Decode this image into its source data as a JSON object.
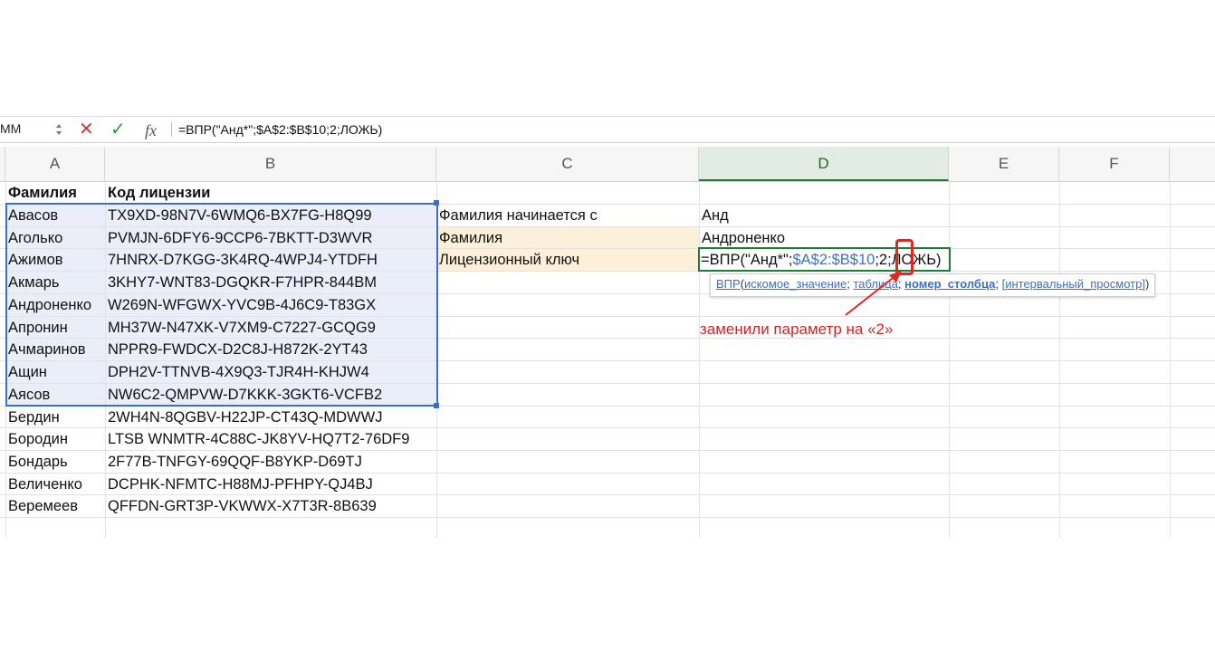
{
  "formula_bar": {
    "name_box": "MM",
    "fx_label": "fx",
    "formula": "=ВПР(\"Анд*\";$A$2:$B$10;2;ЛОЖЬ)"
  },
  "columns": [
    "A",
    "B",
    "C",
    "D",
    "E",
    "F"
  ],
  "headers": {
    "surname": "Фамилия",
    "license": "Код лицензии"
  },
  "rows": [
    {
      "surname": "Авасов",
      "code": "TX9XD-98N7V-6WMQ6-BX7FG-H8Q99"
    },
    {
      "surname": "Аголько",
      "code": "PVMJN-6DFY6-9CCP6-7BKTT-D3WVR"
    },
    {
      "surname": "Ажимов",
      "code": "7HNRX-D7KGG-3K4RQ-4WPJ4-YTDFH"
    },
    {
      "surname": "Акмарь",
      "code": "3KHY7-WNT83-DGQKR-F7HPR-844BM"
    },
    {
      "surname": "Андроненко",
      "code": "W269N-WFGWX-YVC9B-4J6C9-T83GX"
    },
    {
      "surname": "Апронин",
      "code": "MH37W-N47XK-V7XM9-C7227-GCQG9"
    },
    {
      "surname": "Ачмаринов",
      "code": "NPPR9-FWDCX-D2C8J-H872K-2YT43"
    },
    {
      "surname": "Ащин",
      "code": "DPH2V-TTNVB-4X9Q3-TJR4H-KHJW4"
    },
    {
      "surname": "Аясов",
      "code": "NW6C2-QMPVW-D7KKK-3GKT6-VCFB2"
    },
    {
      "surname": "Бердин",
      "code": "2WH4N-8QGBV-H22JP-CT43Q-MDWWJ"
    },
    {
      "surname": "Бородин",
      "code": "LTSB WNMTR-4C88C-JK8YV-HQ7T2-76DF9"
    },
    {
      "surname": "Бондарь",
      "code": "2F77B-TNFGY-69QQF-B8YKP-D69TJ"
    },
    {
      "surname": "Величенко",
      "code": "DCPHK-NFMTC-H88MJ-PFHPY-QJ4BJ"
    },
    {
      "surname": "Веремеев",
      "code": "QFFDN-GRT3P-VKWWX-X7T3R-8B639"
    }
  ],
  "lookup": {
    "starts_label": "Фамилия начинается с",
    "starts_value": "Анд",
    "surname_label": "Фамилия",
    "surname_value": "Андроненко",
    "key_label": "Лицензионный ключ"
  },
  "active_formula": {
    "prefix": "=ВПР(\"Анд*\";",
    "range": "$A$2:$B$10",
    "middle": ";2;",
    "suffix": "ЛОЖЬ)"
  },
  "tooltip": {
    "fn": "ВПР",
    "open": "(",
    "arg1": "искомое_значение",
    "sep": "; ",
    "arg2": "таблица",
    "arg3": "номер_столбца",
    "arg4": "[интервальный_просмотр]",
    "close": ")"
  },
  "annotation": "заменили параметр на «2»",
  "colors": {
    "selection_border": "#3b6fc7",
    "selection_fill": "#e9eef8",
    "label_fill": "#fcf1d8",
    "active_cell": "#1e7b34",
    "annotation": "#d62222"
  }
}
